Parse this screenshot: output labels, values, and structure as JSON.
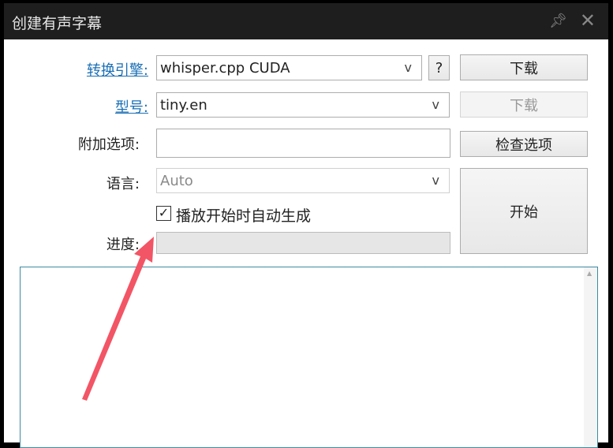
{
  "window": {
    "title": "创建有声字幕"
  },
  "form": {
    "engine_label": "转换引擎:",
    "engine_value": "whisper.cpp CUDA",
    "help_label": "?",
    "download_label": "下载",
    "model_label": "型号:",
    "model_value": "tiny.en",
    "model_download_label": "下载",
    "options_label": "附加选项:",
    "options_value": "",
    "check_options_label": "检查选项",
    "language_label": "语言:",
    "language_value": "Auto",
    "autogen_label": "播放开始时自动生成",
    "autogen_checked": true,
    "start_label": "开始",
    "progress_label": "进度:",
    "progress": 0
  },
  "colors": {
    "annotation_arrow": "#f25565",
    "link": "#1a6fb5"
  }
}
